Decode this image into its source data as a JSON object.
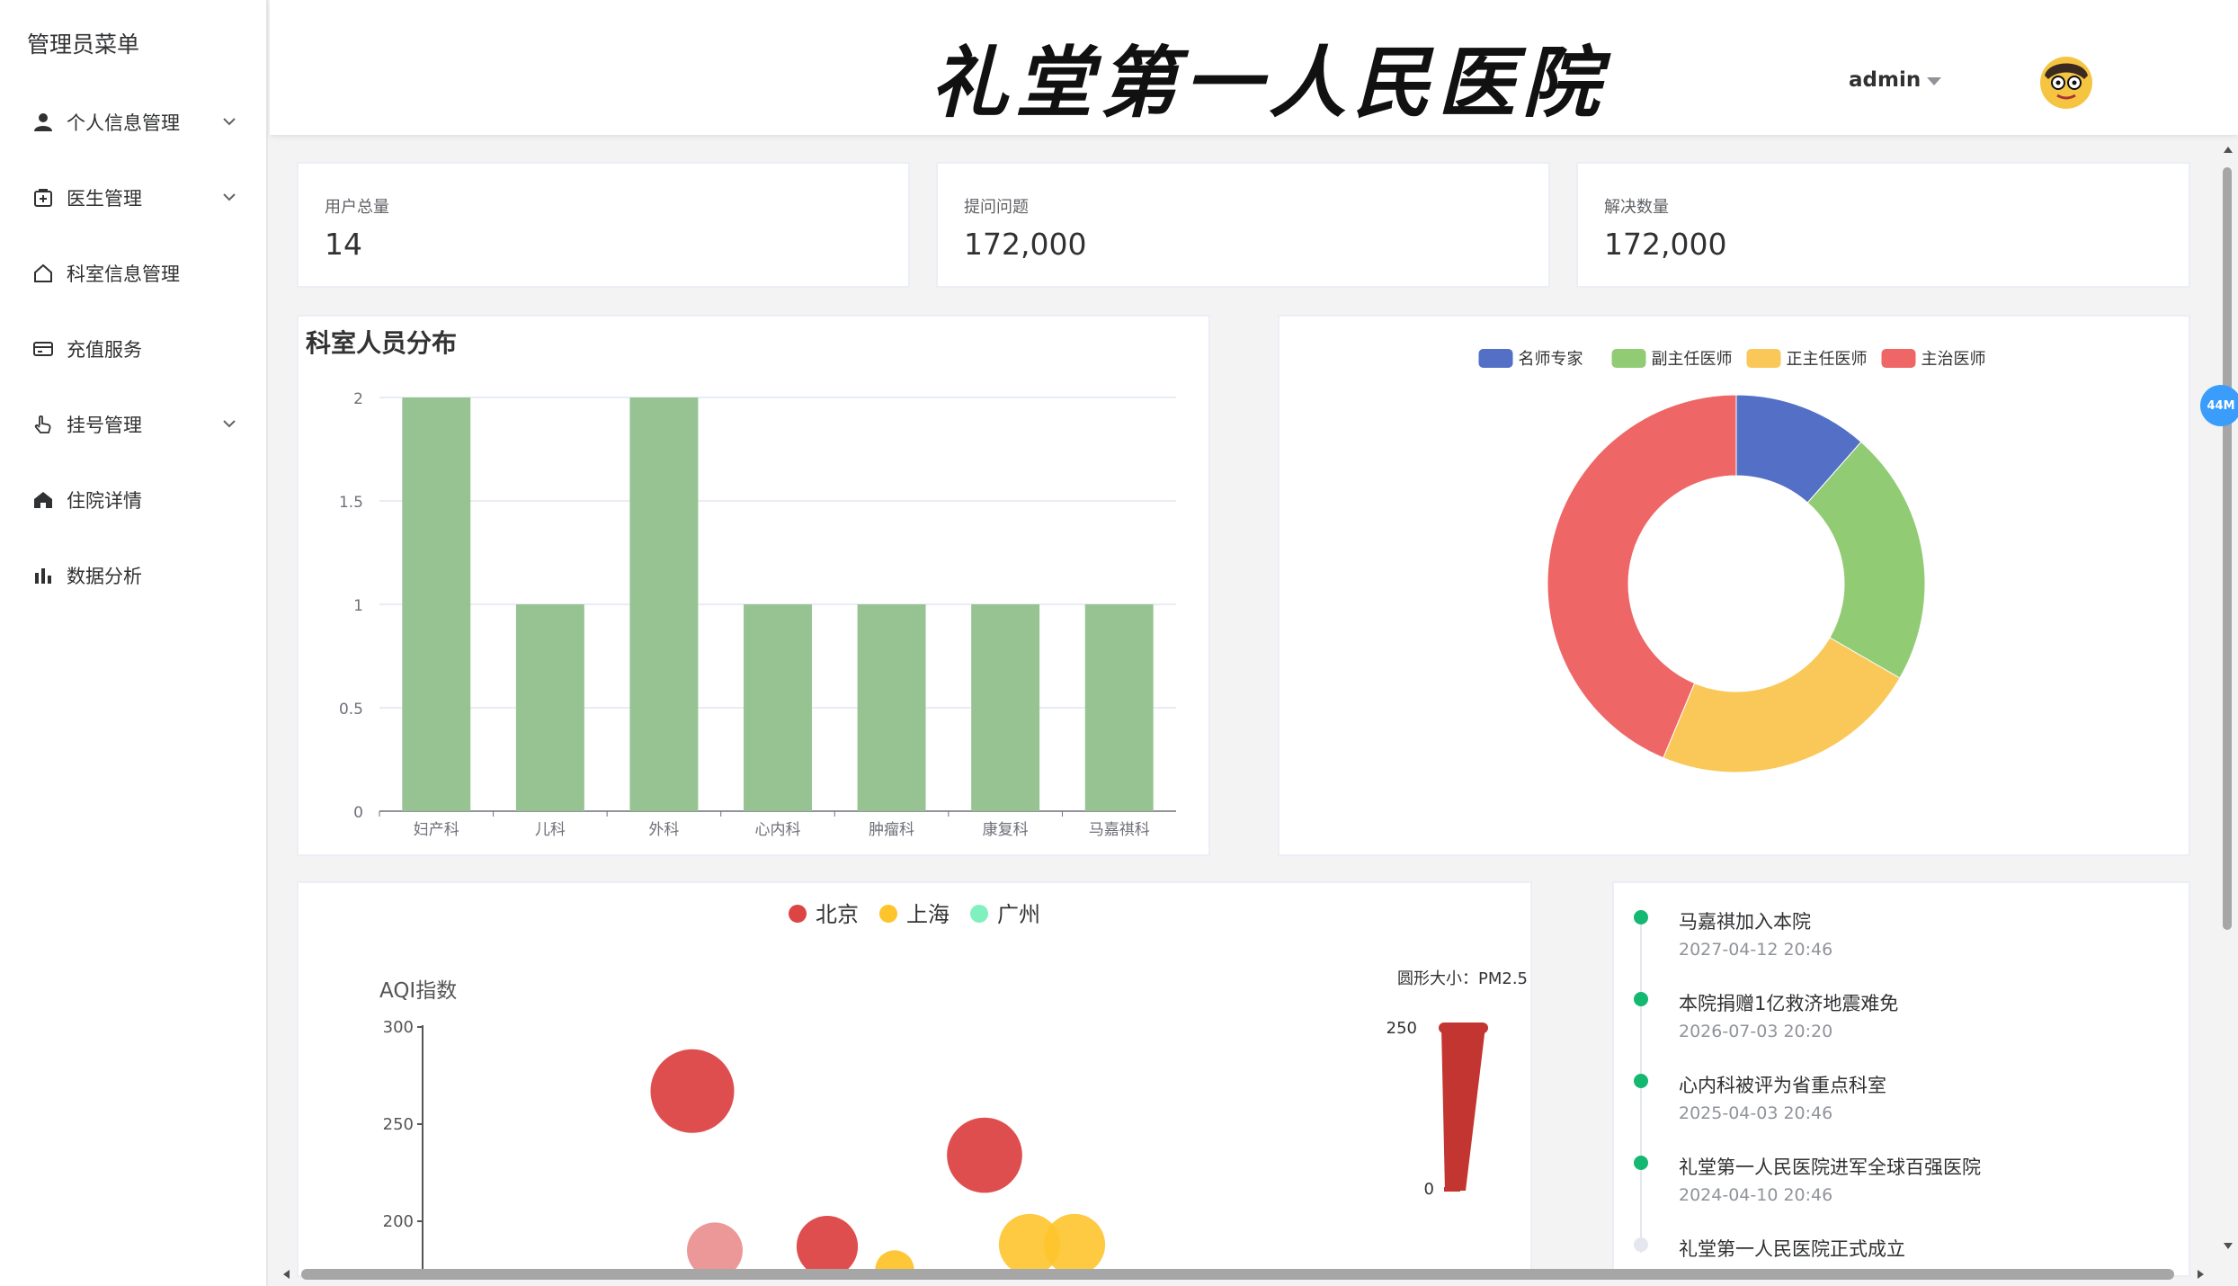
{
  "sidebar": {
    "title": "管理员菜单",
    "items": [
      {
        "label": "个人信息管理",
        "icon": "user-icon",
        "has_submenu": true
      },
      {
        "label": "医生管理",
        "icon": "medical-box-icon",
        "has_submenu": true
      },
      {
        "label": "科室信息管理",
        "icon": "house-outline-icon",
        "has_submenu": false
      },
      {
        "label": "充值服务",
        "icon": "credit-card-icon",
        "has_submenu": false
      },
      {
        "label": "挂号管理",
        "icon": "pointer-hand-icon",
        "has_submenu": true
      },
      {
        "label": "住院详情",
        "icon": "home-filled-icon",
        "has_submenu": false
      },
      {
        "label": "数据分析",
        "icon": "bar-chart-icon",
        "has_submenu": false
      }
    ]
  },
  "header": {
    "title": "礼堂第一人民医院",
    "user": "admin"
  },
  "stats": [
    {
      "label": "用户总量",
      "value": "14"
    },
    {
      "label": "提问问题",
      "value": "172,000"
    },
    {
      "label": "解决数量",
      "value": "172,000"
    }
  ],
  "chart_data": [
    {
      "type": "bar",
      "title": "科室人员分布",
      "categories": [
        "妇产科",
        "儿科",
        "外科",
        "心内科",
        "肿瘤科",
        "康复科",
        "马嘉祺科"
      ],
      "values": [
        2,
        1,
        2,
        1,
        1,
        1,
        1
      ],
      "ylim": [
        0,
        2
      ],
      "yticks": [
        "0",
        "0.5",
        "1",
        "1.5",
        "2"
      ],
      "color": "#97c393",
      "grid": true
    },
    {
      "type": "pie",
      "variant": "donut",
      "legend": [
        "名师专家",
        "副主任医师",
        "正主任医师",
        "主治医师"
      ],
      "values": [
        10,
        19,
        20,
        38
      ],
      "colors": [
        "#5470c6",
        "#91cc75",
        "#fac858",
        "#ee6666"
      ],
      "legend_position": "top"
    },
    {
      "type": "scatter",
      "legend": [
        "北京",
        "上海",
        "广州"
      ],
      "colors": [
        "#dd4444",
        "#fec42c",
        "#80f1be"
      ],
      "ylabel": "AQI指数",
      "yticks": [
        "200",
        "250",
        "300"
      ],
      "visual_map": {
        "label": "圆形大小：PM2.5",
        "max": "250",
        "min": "0",
        "color": "#c23531"
      },
      "points": [
        {
          "series": "北京",
          "x": 12,
          "y": 267,
          "r": 30,
          "opacity": 0.95
        },
        {
          "series": "北京",
          "x": 13,
          "y": 185,
          "r": 20,
          "opacity": 0.55
        },
        {
          "series": "北京",
          "x": 18,
          "y": 187,
          "r": 22,
          "opacity": 0.95
        },
        {
          "series": "北京",
          "x": 25,
          "y": 234,
          "r": 27,
          "opacity": 0.95
        },
        {
          "series": "上海",
          "x": 21,
          "y": 175,
          "r": 14,
          "opacity": 0.95
        },
        {
          "series": "上海",
          "x": 27,
          "y": 188,
          "r": 22,
          "opacity": 0.9
        },
        {
          "series": "上海",
          "x": 29,
          "y": 188,
          "r": 22,
          "opacity": 0.9
        }
      ]
    }
  ],
  "timeline": [
    {
      "text": "马嘉祺加入本院",
      "time": "2027-04-12 20:46",
      "color": "#14b871"
    },
    {
      "text": "本院捐赠1亿救济地震难免",
      "time": "2026-07-03 20:20",
      "color": "#14b871"
    },
    {
      "text": "心内科被评为省重点科室",
      "time": "2025-04-03 20:46",
      "color": "#14b871"
    },
    {
      "text": "礼堂第一人民医院进军全球百强医院",
      "time": "2024-04-10 20:46",
      "color": "#14b871"
    },
    {
      "text": "礼堂第一人民医院正式成立",
      "time": "",
      "color": "#e4e7ed"
    }
  ],
  "floating_badge": "44M"
}
